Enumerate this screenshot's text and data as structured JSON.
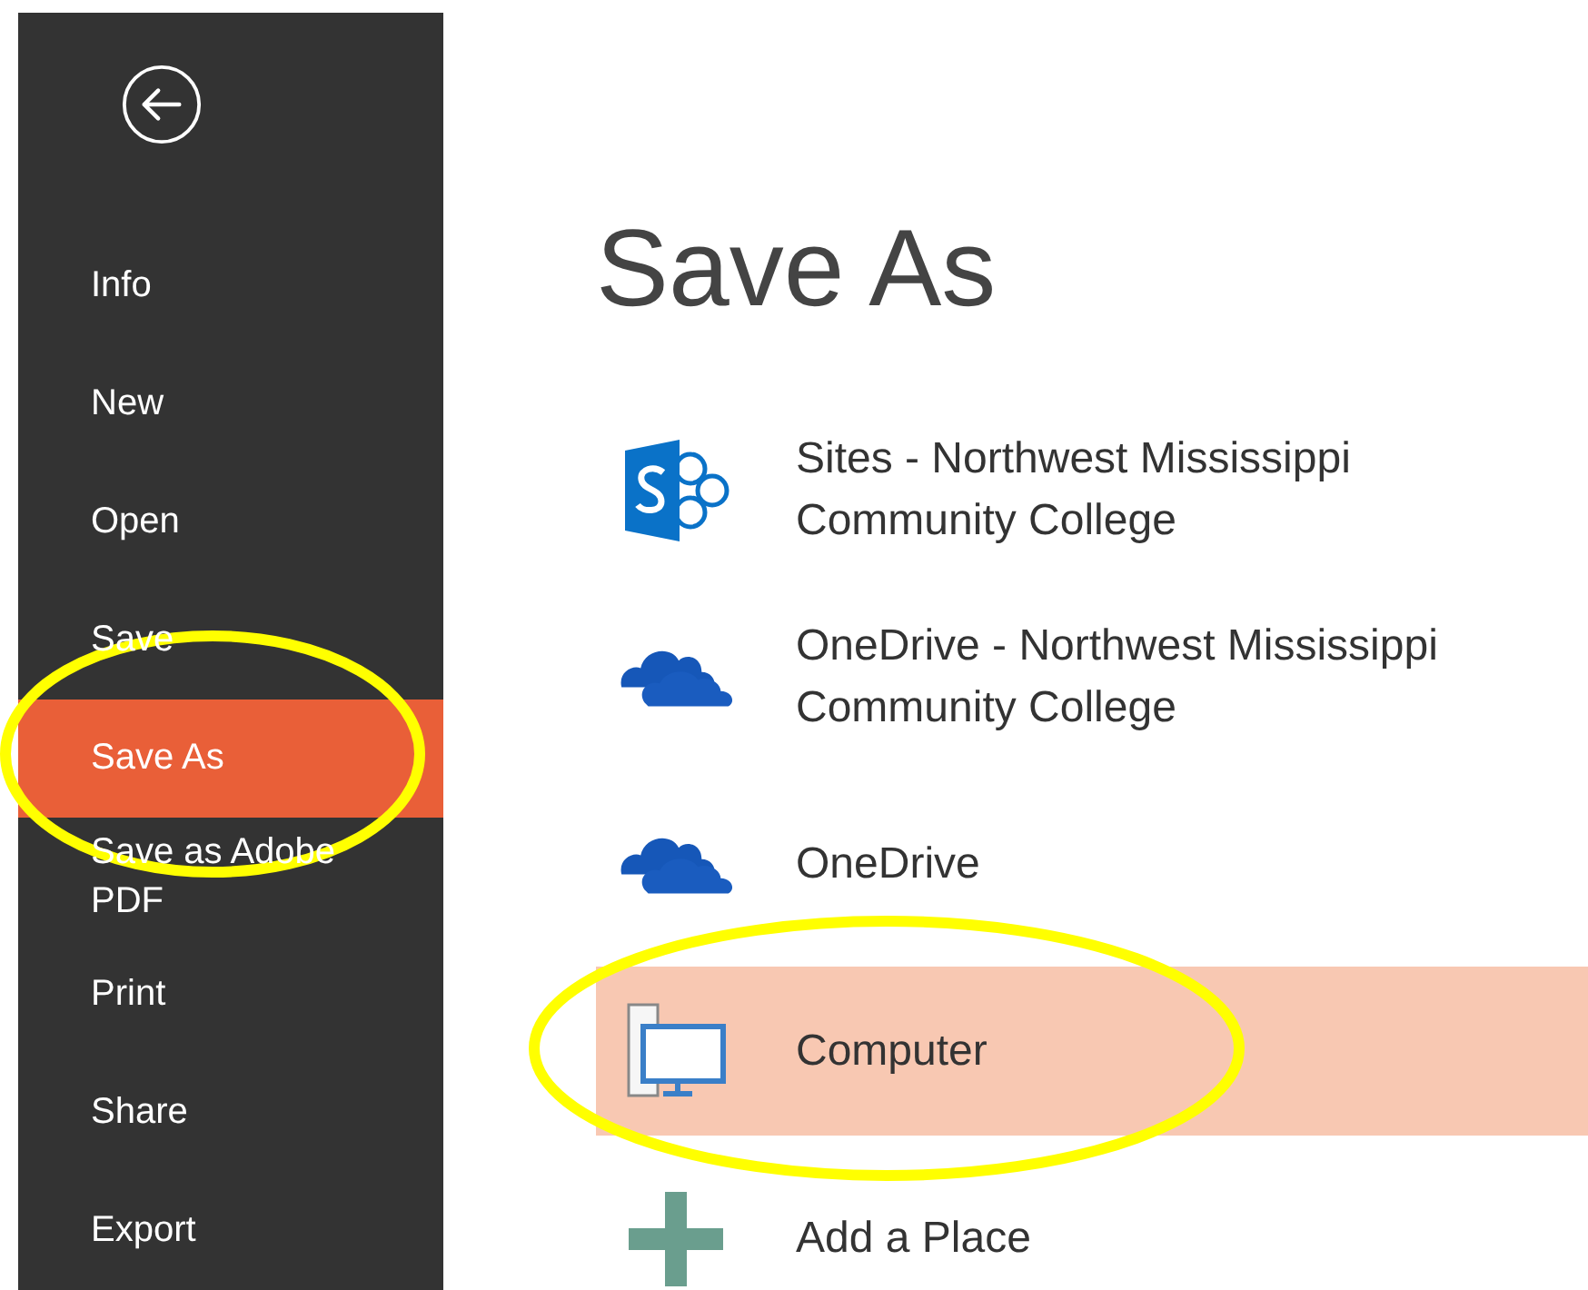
{
  "nav": {
    "items": [
      {
        "label": "Info",
        "selected": false,
        "circled": false
      },
      {
        "label": "New",
        "selected": false,
        "circled": false
      },
      {
        "label": "Open",
        "selected": false,
        "circled": false
      },
      {
        "label": "Save",
        "selected": false,
        "circled": false
      },
      {
        "label": "Save As",
        "selected": true,
        "circled": true
      },
      {
        "label": "Save as Adobe PDF",
        "selected": false,
        "circled": false
      },
      {
        "label": "Print",
        "selected": false,
        "circled": false
      },
      {
        "label": "Share",
        "selected": false,
        "circled": false
      },
      {
        "label": "Export",
        "selected": false,
        "circled": false
      }
    ]
  },
  "main": {
    "title": "Save As",
    "places": [
      {
        "kind": "sharepoint",
        "label": "Sites - Northwest Mississippi Community College",
        "selected": false,
        "circled": false
      },
      {
        "kind": "cloud",
        "label": "OneDrive - Northwest Mississippi Community College",
        "selected": false,
        "circled": false
      },
      {
        "kind": "cloud",
        "label": "OneDrive",
        "selected": false,
        "circled": false
      },
      {
        "kind": "computer",
        "label": "Computer",
        "selected": true,
        "circled": true
      },
      {
        "kind": "add",
        "label": "Add a Place",
        "selected": false,
        "circled": false
      }
    ]
  }
}
